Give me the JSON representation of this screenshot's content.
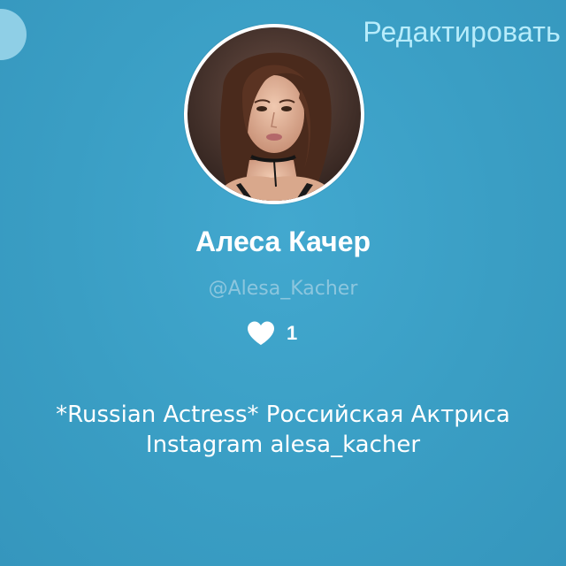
{
  "header": {
    "edit_label": "Редактировать"
  },
  "profile": {
    "name": "Алеса Качер",
    "handle": "@Alesa_Kacher",
    "likes_count": "1",
    "bio_lines": [
      "*Russian Actress* Российская Актриса",
      "Instagram alesa_kacher"
    ]
  },
  "icons": {
    "corner": "circle-button-icon",
    "like": "heart-icon"
  },
  "colors": {
    "background": "#3a9ec4",
    "edit_link": "#b7ecfb",
    "handle": "#8cc6de",
    "text": "#ffffff"
  }
}
